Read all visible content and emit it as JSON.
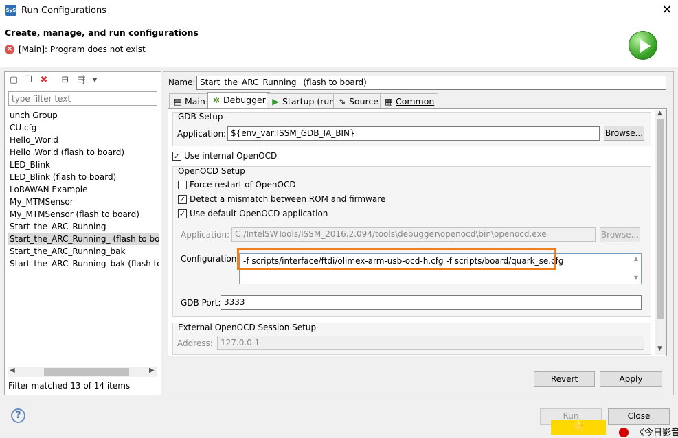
{
  "window": {
    "title": "Run Configurations",
    "app_icon_text": "SyS",
    "close_glyph": "✕"
  },
  "banner": {
    "title": "Create, manage, and run configurations",
    "error_message": "[Main]: Program does not exist"
  },
  "left": {
    "toolbar_icons": [
      "new-config-icon",
      "duplicate-icon",
      "delete-icon",
      "collapse-all-icon",
      "filter-icon",
      "dropdown-arrow-icon"
    ],
    "filter_placeholder": "type filter text",
    "items": [
      "unch Group",
      "CU cfg",
      "Hello_World",
      "Hello_World (flash to board)",
      "LED_Blink",
      "LED_Blink (flash to board)",
      "LoRAWAN Example",
      "My_MTMSensor",
      "My_MTMSensor (flash to board)",
      "Start_the_ARC_Running_",
      "Start_the_ARC_Running_ (flash to board",
      "Start_the_ARC_Running_bak",
      "Start_the_ARC_Running_bak (flash to b"
    ],
    "selected_index": 10,
    "filter_status": "Filter matched 13 of 14 items"
  },
  "right": {
    "name_label": "Name:",
    "name_value": "Start_the_ARC_Running_ (flash to board)",
    "tabs": [
      {
        "label": "Main",
        "icon": "main-tab-icon"
      },
      {
        "label": "Debugger",
        "icon": "bug-icon"
      },
      {
        "label": "Startup (run)",
        "icon": "play-icon"
      },
      {
        "label": "Source",
        "icon": "source-icon"
      },
      {
        "label": "Common",
        "icon": "common-tab-icon"
      }
    ],
    "active_tab": "Debugger",
    "gdb_setup": {
      "title": "GDB Setup",
      "application_label": "Application:",
      "application_value": "${env_var:ISSM_GDB_IA_BIN}",
      "browse_label": "Browse..."
    },
    "use_internal_openocd": {
      "label": "Use internal OpenOCD",
      "checked": true
    },
    "openocd_setup": {
      "title": "OpenOCD Setup",
      "force_restart": {
        "label": "Force restart of OpenOCD",
        "checked": false
      },
      "detect_mismatch": {
        "label": "Detect a mismatch between ROM and firmware",
        "checked": true
      },
      "use_default_app": {
        "label": "Use default OpenOCD application",
        "checked": true
      },
      "application_label": "Application:",
      "application_value": "C:/IntelSWTools/ISSM_2016.2.094/tools\\debugger\\openocd\\bin\\openocd.exe",
      "browse_label": "Browse...",
      "configuration_label": "Configuration:",
      "configuration_value": "-f scripts/interface/ftdi/olimex-arm-usb-ocd-h.cfg -f scripts/board/quark_se.cfg",
      "gdb_port_label": "GDB Port:",
      "gdb_port_value": "3333"
    },
    "external_session": {
      "title": "External OpenOCD Session Setup",
      "address_label": "Address:",
      "address_value": "127.0.0.1"
    },
    "revert_label": "Revert",
    "apply_label": "Apply"
  },
  "footer": {
    "help_glyph": "?",
    "run_label": "Run",
    "close_label": "Close",
    "corner_text": "《今日影音"
  },
  "colors": {
    "highlight": "#f07e1a",
    "selection": "#d9d9d9",
    "error": "#d9534f"
  }
}
